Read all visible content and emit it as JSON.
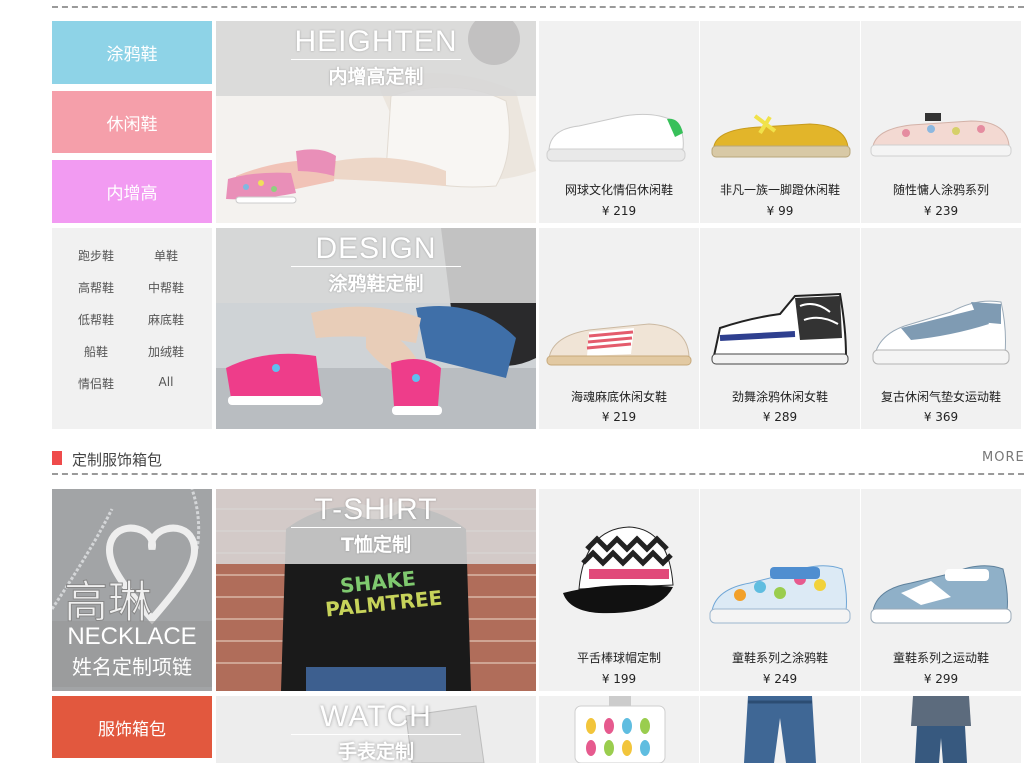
{
  "categories": [
    {
      "label": "涂鸦鞋",
      "color": "#8ed3e7"
    },
    {
      "label": "休闲鞋",
      "color": "#f59faa"
    },
    {
      "label": "内增高",
      "color": "#f29bf2"
    }
  ],
  "subcategories": [
    "跑步鞋",
    "单鞋",
    "高帮鞋",
    "中帮鞋",
    "低帮鞋",
    "麻底鞋",
    "船鞋",
    "加绒鞋",
    "情侣鞋",
    "All"
  ],
  "banners": [
    {
      "en": "HEIGHTEN",
      "cn": "内增高定制"
    },
    {
      "en": "DESIGN",
      "cn": "涂鸦鞋定制"
    },
    {
      "en": "T-SHIRT",
      "cn": "T恤定制"
    },
    {
      "en": "WATCH",
      "cn": "手表定制"
    }
  ],
  "products_row1": [
    {
      "name": "网球文化情侣休闲鞋",
      "price": "¥ 219"
    },
    {
      "name": "非凡一族一脚蹬休闲鞋",
      "price": "¥ 99"
    },
    {
      "name": "随性慵人涂鸦系列",
      "price": "¥ 239"
    }
  ],
  "products_row2": [
    {
      "name": "海魂麻底休闲女鞋",
      "price": "¥ 219"
    },
    {
      "name": "劲舞涂鸦休闲女鞋",
      "price": "¥ 289"
    },
    {
      "name": "复古休闲气垫女运动鞋",
      "price": "¥ 369"
    }
  ],
  "section2": {
    "title": "定制服饰箱包",
    "more": "MORE"
  },
  "necklace": {
    "en": "NECKLACE",
    "cn": "姓名定制项链",
    "engraving": "高琳"
  },
  "apparel_button": {
    "label": "服饰箱包",
    "color": "#e2583e"
  },
  "products_row3": [
    {
      "name": "平舌棒球帽定制",
      "price": "¥ 199"
    },
    {
      "name": "童鞋系列之涂鸦鞋",
      "price": "¥ 249"
    },
    {
      "name": "童鞋系列之运动鞋",
      "price": "¥ 299"
    }
  ],
  "tshirt_print": {
    "line1": "SHAKE",
    "line2": "PALMTREE"
  }
}
